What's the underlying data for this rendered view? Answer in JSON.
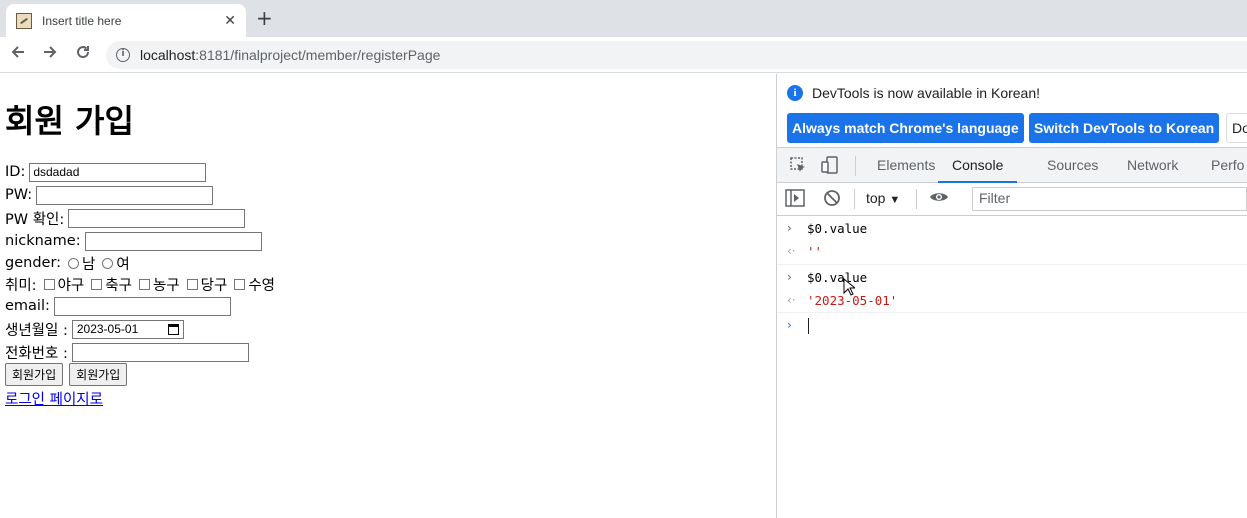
{
  "browser": {
    "tab_title": "Insert title here",
    "close_glyph": "✕",
    "newtab_glyph": "+",
    "url_host": "localhost",
    "url_rest": ":8181/finalproject/member/registerPage"
  },
  "form": {
    "heading": "회원 가입",
    "id_label": "ID:",
    "id_value": "dsdadad",
    "pw_label": "PW:",
    "pw_confirm_label": "PW 확인:",
    "nickname_label": "nickname:",
    "gender_label": "gender:",
    "gender_options": [
      "남",
      "여"
    ],
    "hobby_label": "취미:",
    "hobby_options": [
      "야구",
      "축구",
      "농구",
      "당구",
      "수영"
    ],
    "email_label": "email:",
    "birth_label": "생년월일 :",
    "birth_value": "2023-05-01",
    "phone_label": "전화번호 :",
    "submit_label": "회원가입",
    "button2_label": "회원가입",
    "login_link": "로그인 페이지로"
  },
  "devtools": {
    "notice": "DevTools is now available in Korean!",
    "btn_match": "Always match Chrome's language",
    "btn_switch": "Switch DevTools to Korean",
    "btn_dont": "Do",
    "tabs": [
      "Elements",
      "Console",
      "Sources",
      "Network",
      "Perfo"
    ],
    "active_tab": "Console",
    "context": "top",
    "filter_placeholder": "Filter",
    "console": [
      {
        "kind": "input",
        "text": "$0.value"
      },
      {
        "kind": "result",
        "text": "''"
      },
      {
        "kind": "input",
        "text": "$0.value"
      },
      {
        "kind": "result",
        "text": "'2023-05-01'"
      }
    ],
    "accent": "#1a73e8",
    "string_color": "#c41a16"
  }
}
